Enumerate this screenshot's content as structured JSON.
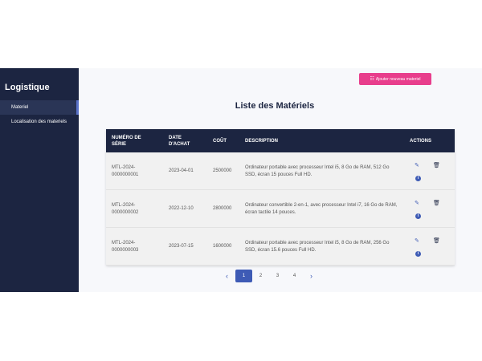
{
  "sidebar": {
    "title": "Logistique",
    "items": [
      {
        "label": "Materiel"
      },
      {
        "label": "Localisation des materiels"
      }
    ]
  },
  "toolbar": {
    "add_icon": "list-icon",
    "add_label": "Ajouter nouveau materiel"
  },
  "page_title": "Liste des Matériels",
  "table": {
    "headers": [
      "NUMÉRO DE SÉRIE",
      "DATE D'ACHAT",
      "COÛT",
      "DESCRIPTION",
      "ACTIONS"
    ],
    "rows": [
      {
        "serie": "MTL-2024-0000000001",
        "date": "2023-04-01",
        "cout": "2500000",
        "description": "Ordinateur portable avec processeur Intel i5, 8 Go de RAM, 512 Go SSD, écran 15 pouces Full HD."
      },
      {
        "serie": "MTL-2024-0000000002",
        "date": "2022-12-10",
        "cout": "2800000",
        "description": "Ordinateur convertible 2-en-1, avec processeur Intel i7, 16 Go de RAM, écran tactile 14 pouces."
      },
      {
        "serie": "MTL-2024-0000000003",
        "date": "2023-07-15",
        "cout": "1600000",
        "description": "Ordinateur portable avec processeur Intel i5, 8 Go de RAM, 256 Go SSD, écran 15.6 pouces Full HD."
      }
    ]
  },
  "pagination": {
    "prev": "‹",
    "pages": [
      "1",
      "2",
      "3",
      "4"
    ],
    "current": "1",
    "next": "›"
  },
  "colors": {
    "sidebar": "#1c2541",
    "accent": "#e83e8c",
    "primary": "#3e5bb5"
  }
}
